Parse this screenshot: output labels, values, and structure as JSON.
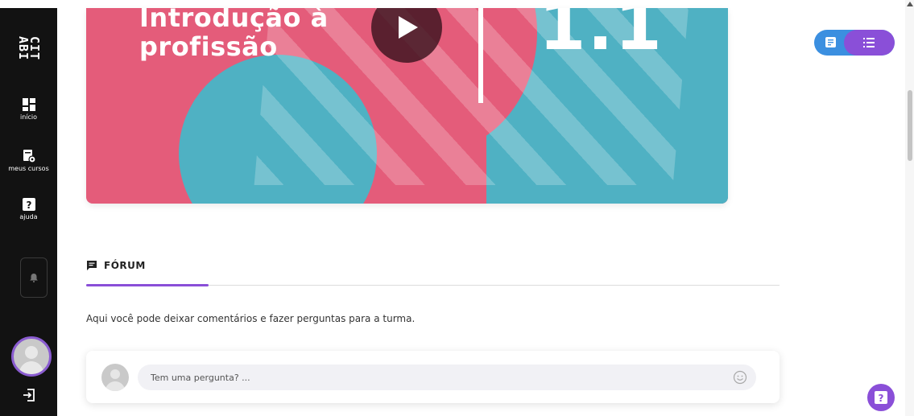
{
  "sidebar": {
    "logo_text": [
      "CIT",
      "ABI"
    ],
    "items": [
      {
        "label": "início",
        "icon": "grid-icon"
      },
      {
        "label": "meus cursos",
        "icon": "book-settings-icon"
      },
      {
        "label": "ajuda",
        "icon": "question-icon"
      }
    ],
    "bell_icon": "bell-icon",
    "logout_icon": "logout-icon"
  },
  "banner": {
    "title_line1": "Introdução à",
    "title_line2": "profissão",
    "lesson_number": "1.1",
    "colors": {
      "pink": "#e45c7a",
      "teal": "#4fb1c3"
    }
  },
  "view_toggle": {
    "left_icon": "notes-icon",
    "right_icon": "list-icon",
    "colors": [
      "#3b8fe0",
      "#8a4fd8"
    ]
  },
  "forum": {
    "heading": "FÓRUM",
    "description": "Aqui você pode deixar comentários e fazer perguntas para a turma.",
    "input_placeholder": "Tem uma pergunta? ...",
    "accent": "#8a4fd8"
  },
  "help_button": {
    "label": "?"
  }
}
